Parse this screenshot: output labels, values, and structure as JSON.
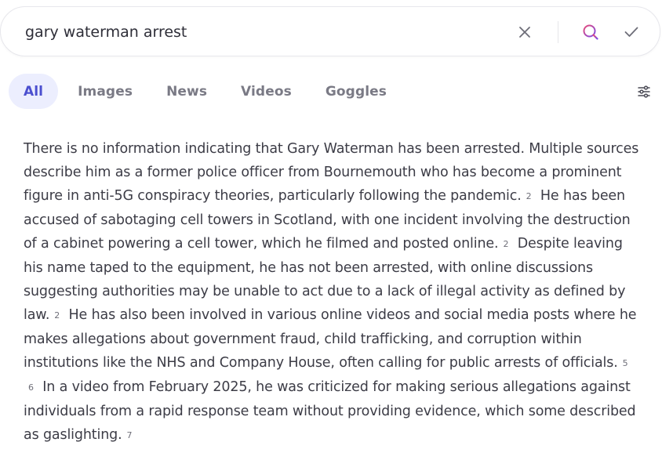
{
  "search": {
    "query": "gary waterman arrest"
  },
  "icons": {
    "clear": "close-icon",
    "search": "search-icon",
    "confirm": "check-icon",
    "filters": "sliders-icon"
  },
  "colors": {
    "accent": "#4b4fcf",
    "active_tab_bg": "#eceefe",
    "search_icon_gradient": [
      "#e84c7a",
      "#7a4ce8"
    ]
  },
  "tabs": [
    {
      "label": "All",
      "active": true
    },
    {
      "label": "Images",
      "active": false
    },
    {
      "label": "News",
      "active": false
    },
    {
      "label": "Videos",
      "active": false
    },
    {
      "label": "Goggles",
      "active": false
    }
  ],
  "answer": {
    "segments": [
      {
        "text": "There is no information indicating that Gary Waterman has been arrested. Multiple sources describe him as a former police officer from Bournemouth who has become a prominent figure in anti-5G conspiracy theories, particularly following the pandemic.",
        "citations": [
          "2"
        ]
      },
      {
        "text": "He has been accused of sabotaging cell towers in Scotland, with one incident involving the destruction of a cabinet powering a cell tower, which he filmed and posted online.",
        "citations": [
          "2"
        ]
      },
      {
        "text": "Despite leaving his name taped to the equipment, he has not been arrested, with online discussions suggesting authorities may be unable to act due to a lack of illegal activity as defined by law.",
        "citations": [
          "2"
        ]
      },
      {
        "text": "He has also been involved in various online videos and social media posts where he makes allegations about government fraud, child trafficking, and corruption within institutions like the NHS and Company House, often calling for public arrests of officials.",
        "citations": [
          "5",
          "6"
        ]
      },
      {
        "text": "In a video from February 2025, he was criticized for making serious allegations against individuals from a rapid response team without providing evidence, which some described as gaslighting.",
        "citations": [
          "7"
        ]
      }
    ]
  }
}
